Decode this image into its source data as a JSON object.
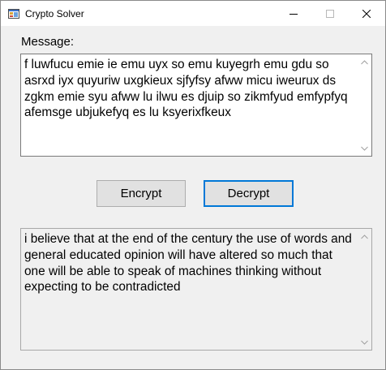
{
  "window": {
    "title": "Crypto Solver",
    "icons": [
      "app-icon",
      "minimize-icon",
      "maximize-icon",
      "close-icon"
    ]
  },
  "message_label": "Message:",
  "message_text": "f luwfucu emie ie emu uyx so emu kuyegrh emu gdu so asrxd iyx quyuriw uxgkieux sjfyfsy afww micu iweurux ds zgkm emie syu afww lu ilwu es djuip so zikmfyud emfypfyq afemsge ubjukefyq es lu ksyerixfkeux",
  "buttons": {
    "encrypt": "Encrypt",
    "decrypt": "Decrypt"
  },
  "output_text": "i believe that at the end of the century the use of words and general educated opinion will have altered so much that one will be able to speak of machines thinking without expecting to be contradicted",
  "colors": {
    "focus_border": "#0078d7",
    "button_face": "#e1e1e1",
    "window_bg": "#f0f0f0"
  }
}
